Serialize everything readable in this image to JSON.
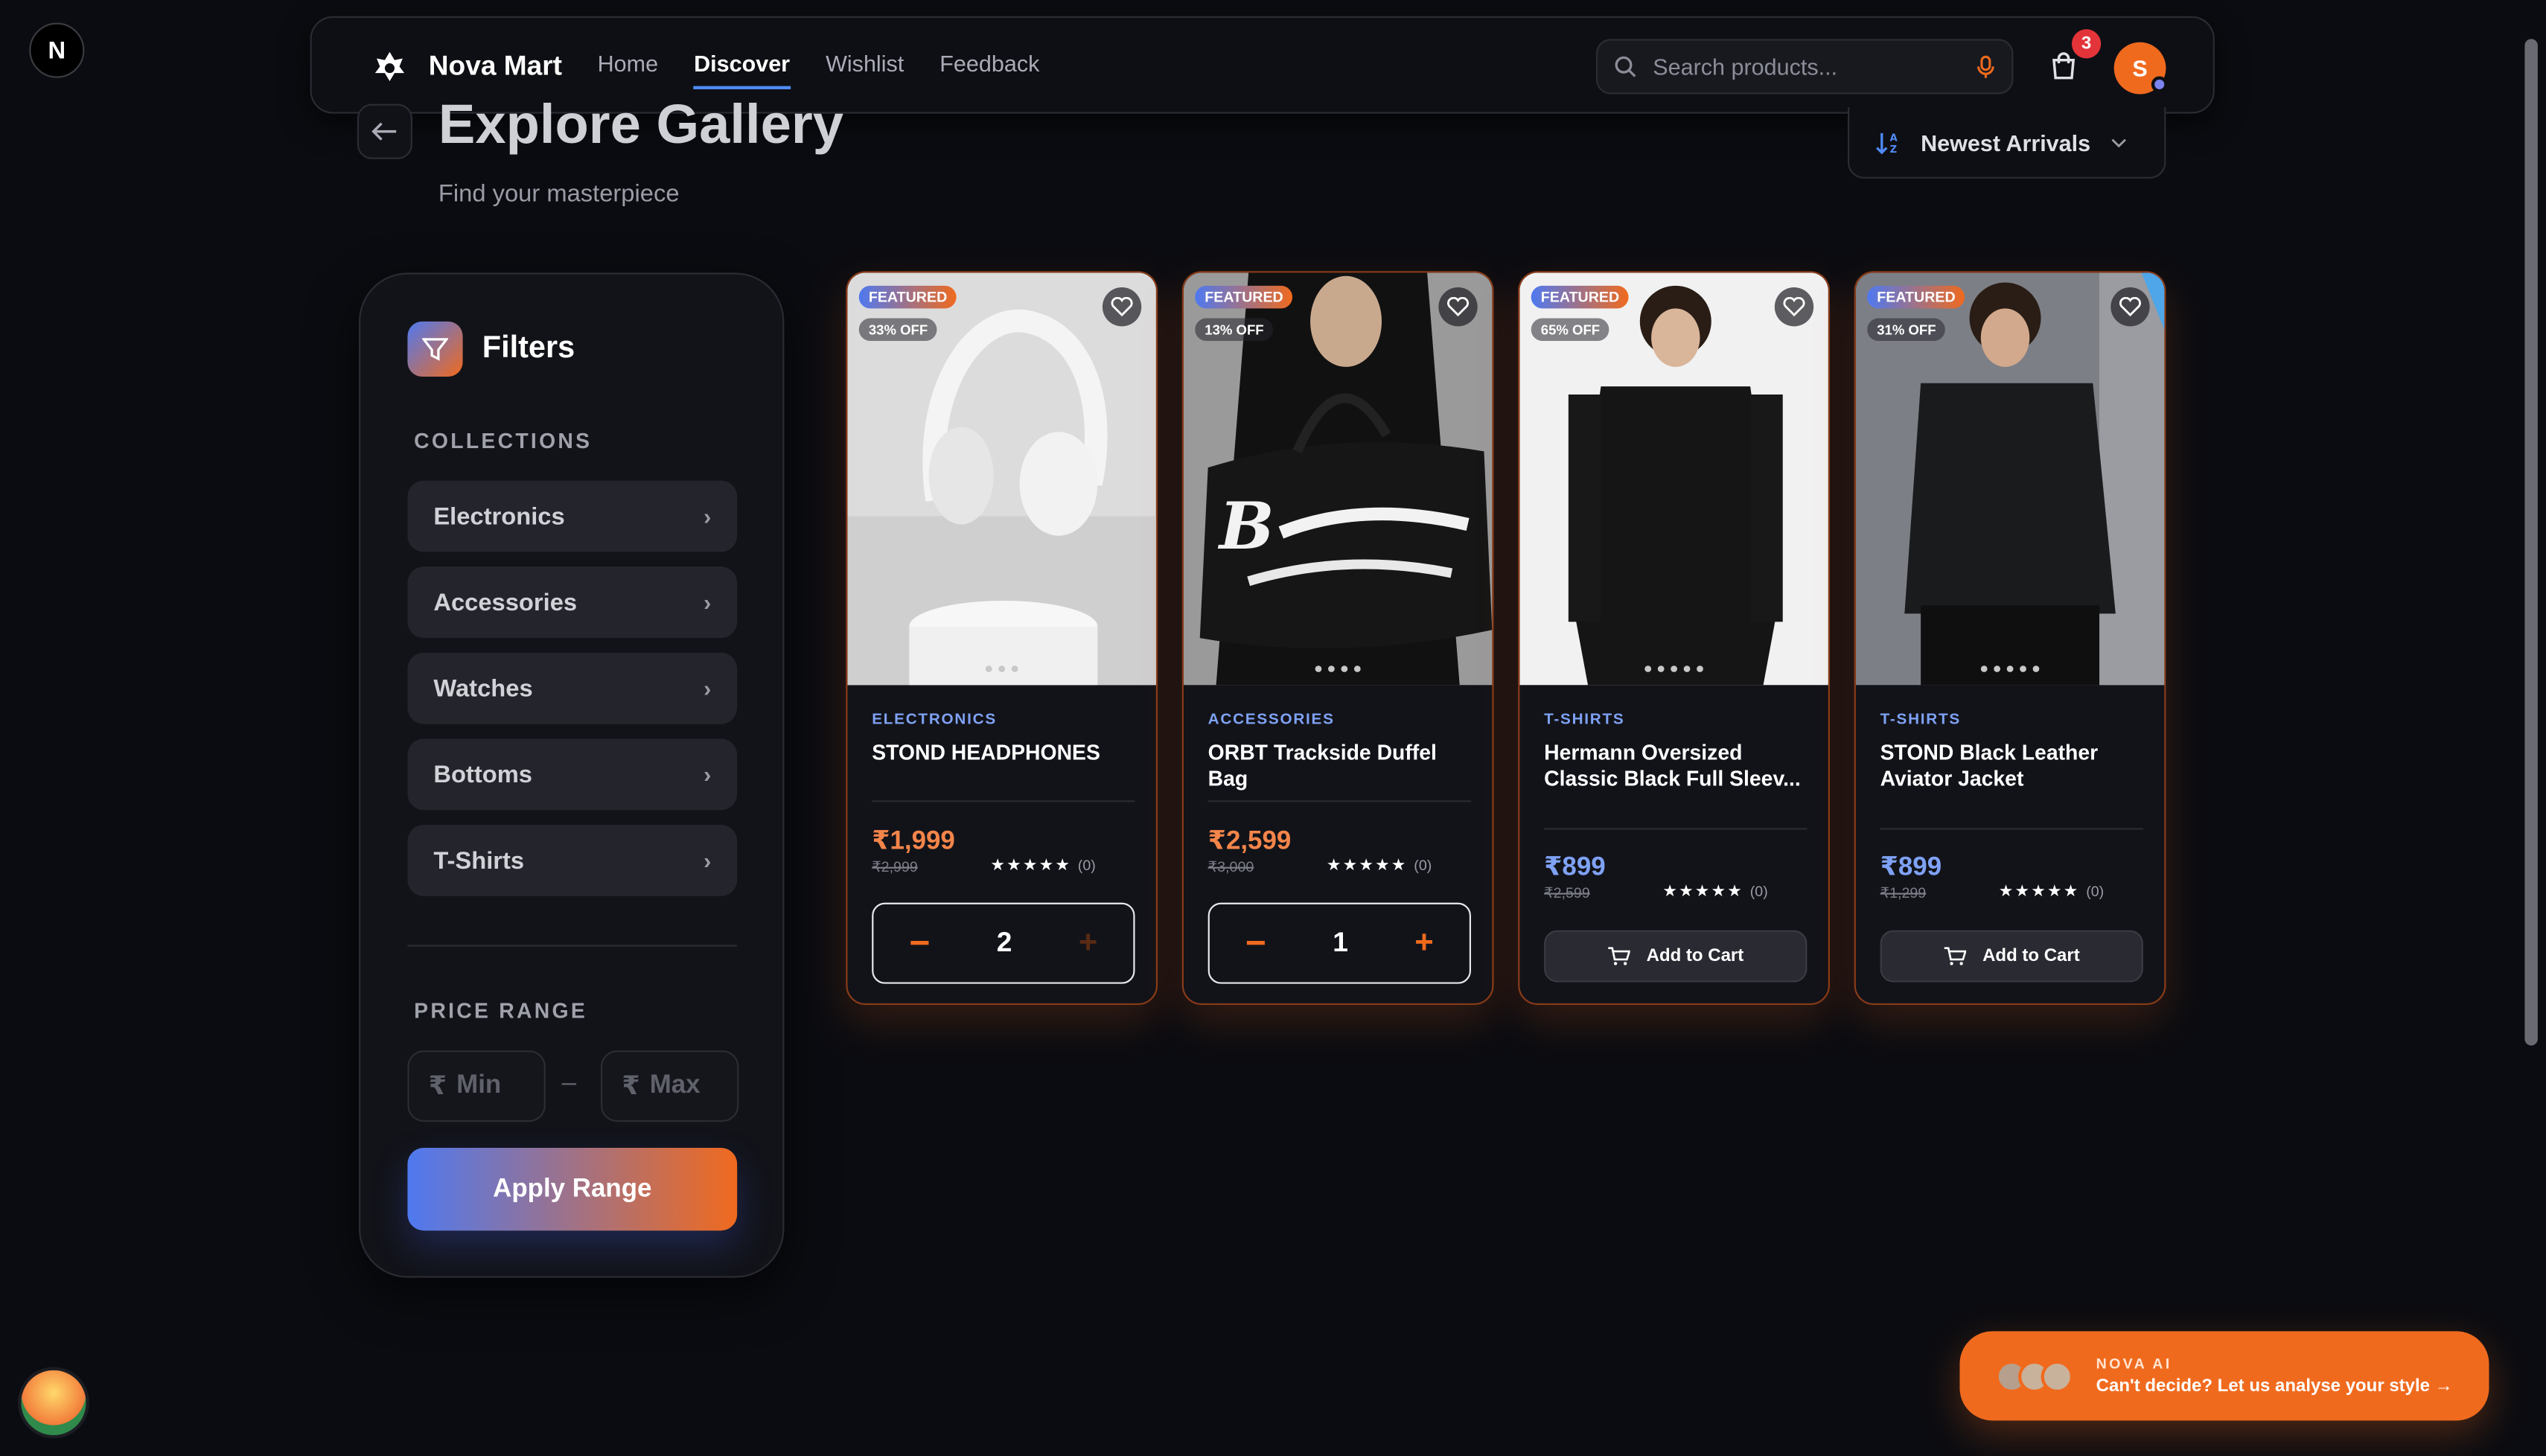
{
  "app": {
    "name": "Nova Mart"
  },
  "nav": {
    "links": [
      "Home",
      "Discover",
      "Wishlist",
      "Feedback"
    ],
    "active": "Discover",
    "search_placeholder": "Search products...",
    "cart_count": "3",
    "avatar_initial": "S"
  },
  "page": {
    "title": "Explore Gallery",
    "subtitle": "Find your masterpiece"
  },
  "sort": {
    "label": "Newest Arrivals"
  },
  "filters": {
    "title": "Filters",
    "collections_label": "COLLECTIONS",
    "collections": [
      "Electronics",
      "Accessories",
      "Watches",
      "Bottoms",
      "T-Shirts"
    ],
    "price_label": "PRICE RANGE",
    "min_placeholder": "Min",
    "max_placeholder": "Max",
    "currency": "₹",
    "apply_label": "Apply Range"
  },
  "products": [
    {
      "badge": "FEATURED",
      "discount": "33% OFF",
      "category": "ELECTRONICS",
      "name": "STOND HEADPHONES",
      "price": "₹1,999",
      "mrp": "₹2,999",
      "reviews": "(0)",
      "qty": "2",
      "in_cart": true
    },
    {
      "badge": "FEATURED",
      "discount": "13% OFF",
      "category": "ACCESSORIES",
      "name": "ORBT Trackside Duffel Bag",
      "price": "₹2,599",
      "mrp": "₹3,000",
      "reviews": "(0)",
      "qty": "1",
      "in_cart": true
    },
    {
      "badge": "FEATURED",
      "discount": "65% OFF",
      "category": "T-SHIRTS",
      "name": "Hermann Oversized Classic Black Full Sleev...",
      "price": "₹899",
      "mrp": "₹2,599",
      "reviews": "(0)",
      "add_label": "Add to Cart",
      "in_cart": false
    },
    {
      "badge": "FEATURED",
      "discount": "31% OFF",
      "category": "T-SHIRTS",
      "name": "STOND Black Leather Aviator Jacket",
      "price": "₹899",
      "mrp": "₹1,299",
      "reviews": "(0)",
      "add_label": "Add to Cart",
      "in_cart": false
    }
  ],
  "nova": {
    "label": "NOVA AI",
    "text": "Can't decide? Let us analyse your style"
  },
  "colors": {
    "accent_orange": "#f06a1e",
    "accent_blue": "#4f79f0",
    "background": "#0b0c11"
  }
}
